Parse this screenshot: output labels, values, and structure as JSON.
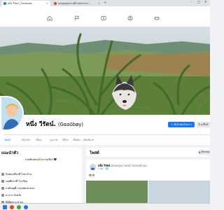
{
  "browser": {
    "tabs": [
      {
        "title": "หนึ่ง วีรัตน์ | Facebook",
        "active": true
      },
      {
        "title": "ขอบคุณทุกท่านที่ร่วมกิจกรรม ...",
        "active": false
      }
    ],
    "new_tab": "+",
    "window_controls": [
      "–",
      "□",
      "✕"
    ]
  },
  "fb_nav": {
    "icons": [
      "home-icon",
      "flag-icon",
      "watch-icon",
      "groups-icon",
      "gaming-icon"
    ]
  },
  "profile": {
    "name": "หนึ่ง วีรัตน์.",
    "alt_name": "(Gααδbøy)",
    "add_story_label": "เพิ่มไปยังเรื่องราว",
    "edit_label": "แก้ไขโ",
    "tabs": [
      "โพสต์",
      "เกี่ยวกับ",
      "เพื่อน",
      "รูปภาพ",
      "วิดีโอ",
      "เช็คอิน"
    ],
    "more_label": "เพิ่มเติม ▾"
  },
  "intro": {
    "title": "แนะนำตัว",
    "bio": "ถ่ายชัดเสมอ🔥ความเชื่อ✌🖤",
    "rows": [
      "นักท่องเที่ยวที่ ไร่ชาบ้าน",
      "เคยศึกษาที่ โรงเรียน",
      "อาศัยอยู่ที่ กรุงเทพมหานคร",
      "มาจาก จังหวัด",
      "มีผู้ติดตาม 6 คน"
    ]
  },
  "posts": {
    "title": "โพสต์",
    "filter_label": "ตัวกรอง",
    "post": {
      "author": "หนึ่ง วีรัตน์",
      "action": "อัปเดตรูปภาพหน้าปกของตัวเอง",
      "time": "1 ชม. · 🌐",
      "emoji": "😎🌴"
    }
  },
  "colors": {
    "fb_blue": "#1877f2",
    "page_bg": "#f0f2f5",
    "tab_bar": "#dee1e6"
  }
}
